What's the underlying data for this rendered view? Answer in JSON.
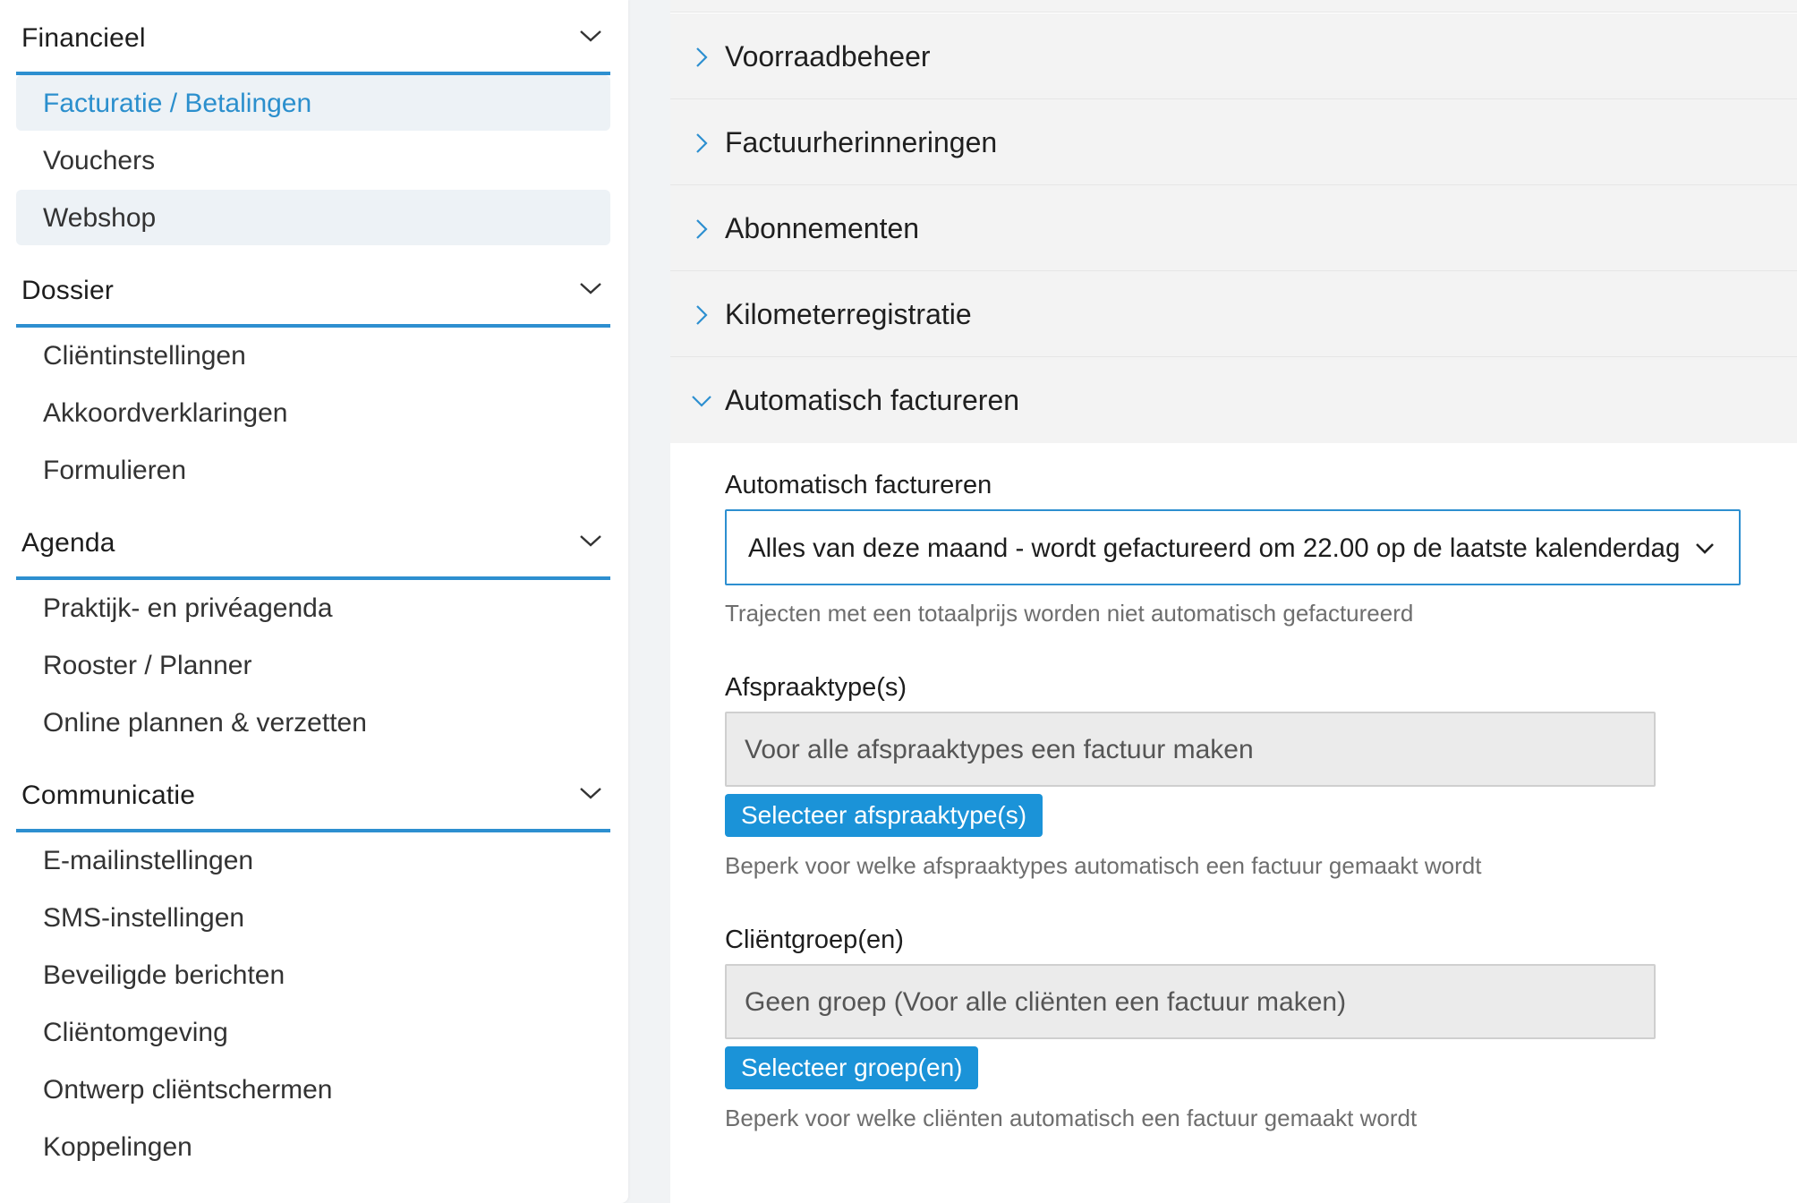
{
  "sidebar": {
    "sections": [
      {
        "title": "Financieel",
        "items": [
          "Facturatie / Betalingen",
          "Vouchers",
          "Webshop"
        ]
      },
      {
        "title": "Dossier",
        "items": [
          "Cliëntinstellingen",
          "Akkoordverklaringen",
          "Formulieren"
        ]
      },
      {
        "title": "Agenda",
        "items": [
          "Praktijk- en privéagenda",
          "Rooster / Planner",
          "Online plannen & verzetten"
        ]
      },
      {
        "title": "Communicatie",
        "items": [
          "E-mailinstellingen",
          "SMS-instellingen",
          "Beveiligde berichten",
          "Cliëntomgeving",
          "Ontwerp cliëntschermen",
          "Koppelingen"
        ]
      }
    ],
    "active_item": "Facturatie / Betalingen"
  },
  "main": {
    "accordion": [
      {
        "label": "Voorraadbeheer",
        "open": false
      },
      {
        "label": "Factuurherinneringen",
        "open": false
      },
      {
        "label": "Abonnementen",
        "open": false
      },
      {
        "label": "Kilometerregistratie",
        "open": false
      },
      {
        "label": "Automatisch factureren",
        "open": true
      }
    ],
    "auto_invoice": {
      "label": "Automatisch factureren",
      "selected": "Alles van deze maand - wordt gefactureerd om 22.00 op de laatste kalenderdag",
      "hint": "Trajecten met een totaalprijs worden niet automatisch gefactureerd"
    },
    "appointment_types": {
      "label": "Afspraaktype(s)",
      "value": "Voor alle afspraaktypes een factuur maken",
      "button": "Selecteer afspraaktype(s)",
      "hint": "Beperk voor welke afspraaktypes automatisch een factuur gemaakt wordt"
    },
    "client_groups": {
      "label": "Cliëntgroep(en)",
      "value": "Geen groep (Voor alle cliënten een factuur maken)",
      "button": "Selecteer groep(en)",
      "hint": "Beperk voor welke cliënten automatisch een factuur gemaakt wordt"
    }
  },
  "colors": {
    "accent": "#2d8fd0",
    "button": "#1b93d8",
    "active_text": "#2b8fcd",
    "highlight_bg": "#edf2f6",
    "accordion_bg": "#f3f3f3"
  },
  "icons": {
    "section_toggle": "chevron-down-icon",
    "accordion_closed": "chevron-right-icon",
    "accordion_open": "chevron-down-icon",
    "select": "chevron-down-icon"
  }
}
